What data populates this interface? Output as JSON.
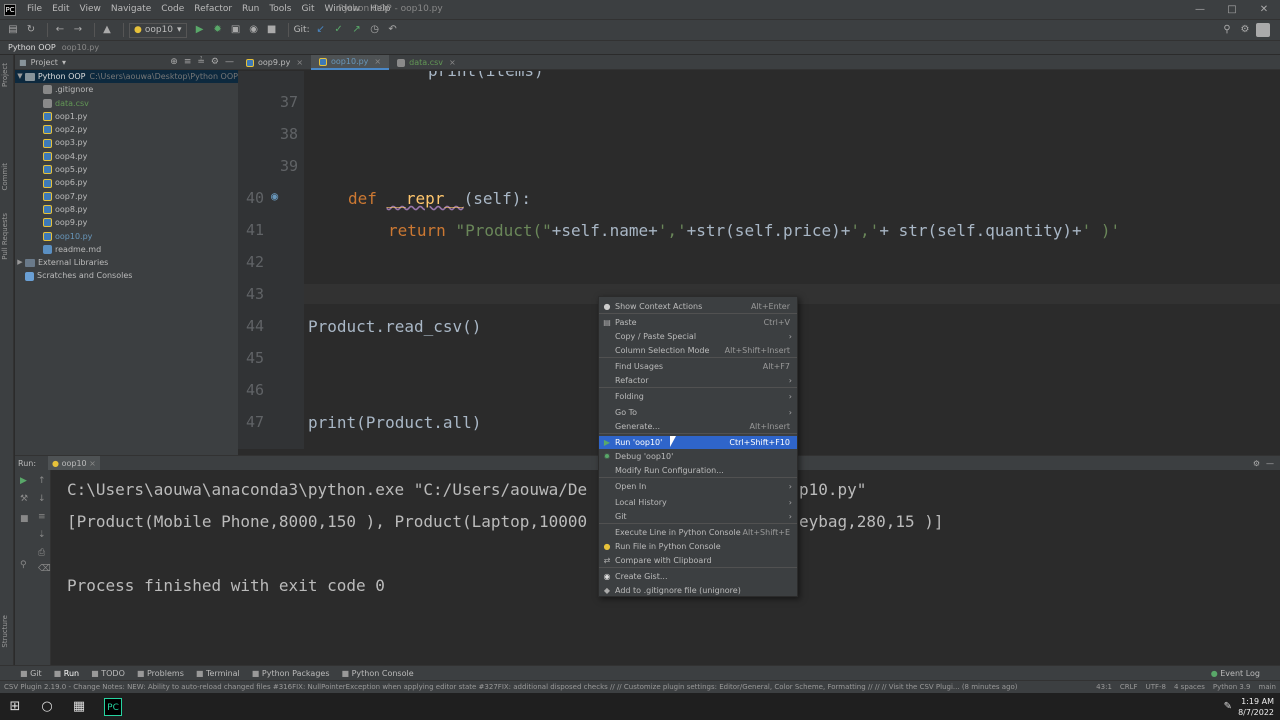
{
  "titlebar": {
    "menus": [
      "File",
      "Edit",
      "View",
      "Navigate",
      "Code",
      "Refactor",
      "Run",
      "Tools",
      "Git",
      "Window",
      "Help"
    ],
    "title": "Python OOP - oop10.py"
  },
  "toolbar": {
    "run_config": "oop10",
    "git_label": "Git:"
  },
  "navbar": {
    "project": "Python OOP",
    "file": "oop10.py"
  },
  "project_panel": {
    "label": "Project",
    "root": "Python OOP",
    "root_path": "C:\\Users\\aouwa\\Desktop\\Python OOP",
    "files": [
      ".gitignore",
      "data.csv",
      "oop1.py",
      "oop2.py",
      "oop3.py",
      "oop4.py",
      "oop5.py",
      "oop6.py",
      "oop7.py",
      "oop8.py",
      "oop9.py",
      "oop10.py",
      "readme.md"
    ],
    "external": "External Libraries",
    "scratches": "Scratches and Consoles"
  },
  "tabs": [
    "oop9.py",
    "oop10.py",
    "data.csv"
  ],
  "editor": {
    "lines": [
      "37",
      "38",
      "39",
      "40",
      "41",
      "42",
      "43",
      "44",
      "45",
      "46",
      "47"
    ],
    "top_partial": "print(items)",
    "def_kw": "def",
    "def_name": "__repr__",
    "def_params": "(self):",
    "return_kw": "return",
    "return_str1": "\"Product(\"",
    "return_mid1": "+self.name+",
    "return_str2": "','",
    "return_mid2": "+str(self.price)+",
    "return_str3": "','",
    "return_mid3": "+ str(self.quantity)+",
    "return_str4": "' )'",
    "call1": "Product.read_csv()",
    "call2": "print(Product.all)"
  },
  "run_panel": {
    "label": "Run:",
    "tab": "oop10",
    "line1": "C:\\Users\\aouwa\\anaconda3\\python.exe \"C:/Users/aouwa/De",
    "line1_end": "p10.py\"",
    "line2": "[Product(Mobile Phone,8000,150 ), Product(Laptop,10000",
    "line2_end": "eybag,280,15 )]",
    "line3": "Process finished with exit code 0"
  },
  "bottom_tools": [
    "Git",
    "Run",
    "TODO",
    "Problems",
    "Terminal",
    "Python Packages",
    "Python Console"
  ],
  "bottom_right": "Event Log",
  "status": {
    "message": "CSV Plugin 2.19.0 - Change Notes: NEW: Ability to auto-reload changed files #316FIX: NullPointerException when applying editor state #327FIX: additional disposed checks   // // Customize plugin settings: Editor/General, Color Scheme, Formatting // // // Visit the CSV Plugi... (8 minutes ago)",
    "position": "43:1",
    "line_sep": "CRLF",
    "encoding": "UTF-8",
    "indent": "4 spaces",
    "interpreter": "Python 3.9",
    "branch": "main"
  },
  "taskbar": {
    "time": "1:19 AM",
    "date": "8/7/2022"
  },
  "context_menu": {
    "items": [
      {
        "label": "Show Context Actions",
        "shortcut": "Alt+Enter",
        "icon": "bulb-icon"
      },
      {
        "label": "Paste",
        "shortcut": "Ctrl+V",
        "icon": "clipboard-icon"
      },
      {
        "label": "Copy / Paste Special",
        "shortcut": "",
        "sub": true
      },
      {
        "label": "Column Selection Mode",
        "shortcut": "Alt+Shift+Insert"
      },
      {
        "label": "Find Usages",
        "shortcut": "Alt+F7"
      },
      {
        "label": "Refactor",
        "shortcut": "",
        "sub": true
      },
      {
        "label": "Folding",
        "shortcut": "",
        "sub": true
      },
      {
        "label": "Go To",
        "shortcut": "",
        "sub": true
      },
      {
        "label": "Generate...",
        "shortcut": "Alt+Insert"
      },
      {
        "label": "Run 'oop10'",
        "shortcut": "Ctrl+Shift+F10",
        "icon": "run-icon",
        "highlighted": true
      },
      {
        "label": "Debug 'oop10'",
        "shortcut": "",
        "icon": "debug-icon"
      },
      {
        "label": "Modify Run Configuration...",
        "shortcut": ""
      },
      {
        "label": "Open In",
        "shortcut": "",
        "sub": true
      },
      {
        "label": "Local History",
        "shortcut": "",
        "sub": true
      },
      {
        "label": "Git",
        "shortcut": "",
        "sub": true
      },
      {
        "label": "Execute Line in Python Console",
        "shortcut": "Alt+Shift+E"
      },
      {
        "label": "Run File in Python Console",
        "shortcut": "",
        "icon": "python-icon"
      },
      {
        "label": "Compare with Clipboard",
        "shortcut": "",
        "icon": "compare-icon"
      },
      {
        "label": "Create Gist...",
        "shortcut": "",
        "icon": "github-icon"
      },
      {
        "label": "Add to .gitignore file (unignore)",
        "shortcut": "",
        "icon": "gitignore-icon"
      }
    ]
  }
}
